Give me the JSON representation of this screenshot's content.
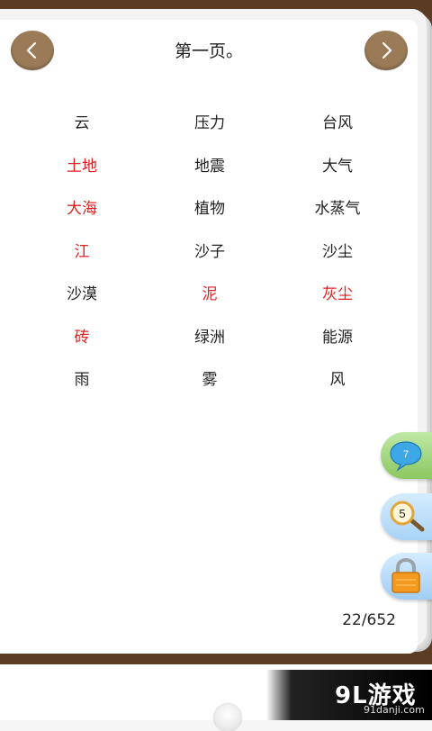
{
  "header": {
    "title": "第一页。"
  },
  "words": [
    {
      "text": "云",
      "color": "#222222"
    },
    {
      "text": "压力",
      "color": "#222222"
    },
    {
      "text": "台风",
      "color": "#222222"
    },
    {
      "text": "土地",
      "color": "#e02020"
    },
    {
      "text": "地震",
      "color": "#222222"
    },
    {
      "text": "大气",
      "color": "#222222"
    },
    {
      "text": "大海",
      "color": "#e02020"
    },
    {
      "text": "植物",
      "color": "#222222"
    },
    {
      "text": "水蒸气",
      "color": "#222222"
    },
    {
      "text": "江",
      "color": "#e02020"
    },
    {
      "text": "沙子",
      "color": "#222222"
    },
    {
      "text": "沙尘",
      "color": "#222222"
    },
    {
      "text": "沙漠",
      "color": "#222222"
    },
    {
      "text": "泥",
      "color": "#e02020"
    },
    {
      "text": "灰尘",
      "color": "#e02020"
    },
    {
      "text": "砖",
      "color": "#e02020"
    },
    {
      "text": "绿洲",
      "color": "#222222"
    },
    {
      "text": "能源",
      "color": "#222222"
    },
    {
      "text": "雨",
      "color": "#222222"
    },
    {
      "text": "雾",
      "color": "#222222"
    },
    {
      "text": "风",
      "color": "#222222"
    }
  ],
  "footer": {
    "page_indicator": "22/652"
  },
  "side_buttons": {
    "chat_count": "7",
    "search_count": "5"
  },
  "watermark": {
    "main": "9L游戏",
    "sub": "91danji.com"
  },
  "icons": {
    "prev": "chevron-left-icon",
    "next": "chevron-right-icon",
    "chat": "chat-bubble-icon",
    "search": "magnifier-icon",
    "lock": "lock-icon"
  }
}
